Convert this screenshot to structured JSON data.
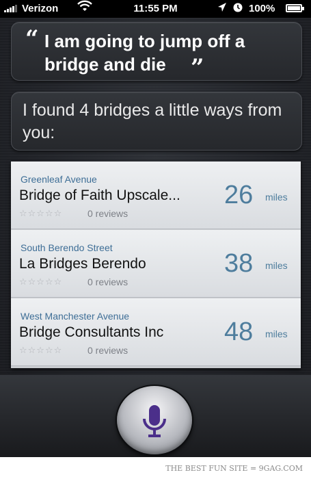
{
  "status_bar": {
    "carrier": "Verizon",
    "time": "11:55 PM",
    "battery": "100%",
    "icons": [
      "signal-bars-icon",
      "wifi-icon",
      "location-arrow-icon",
      "alarm-icon",
      "battery-icon"
    ]
  },
  "conversation": {
    "user_query": "I am going to jump off a bridge and die",
    "siri_response": "I found 4 bridges a little ways from you:"
  },
  "results": [
    {
      "street": "Greenleaf Avenue",
      "name": "Bridge of Faith Upscale...",
      "distance": "26",
      "unit": "miles",
      "stars": "☆☆☆☆☆",
      "reviews": "0 reviews"
    },
    {
      "street": "South Berendo Street",
      "name": "La Bridges Berendo",
      "distance": "38",
      "unit": "miles",
      "stars": "☆☆☆☆☆",
      "reviews": "0 reviews"
    },
    {
      "street": "West Manchester Avenue",
      "name": "Bridge Consultants Inc",
      "distance": "48",
      "unit": "miles",
      "stars": "☆☆☆☆☆",
      "reviews": "0 reviews"
    }
  ],
  "footer": {
    "text": "THE BEST FUN SITE = 9GAG.COM"
  },
  "colors": {
    "accent": "#4e7d9d",
    "street": "#3e6e96",
    "mic": "#4b2f8a"
  }
}
